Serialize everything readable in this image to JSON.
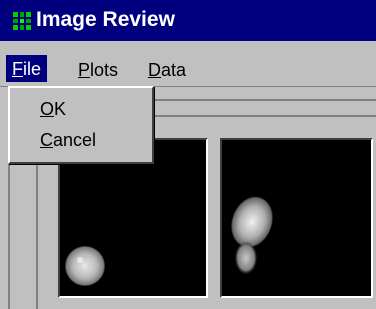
{
  "window": {
    "title": "Image Review",
    "titlebar_color": "#00007e",
    "icon": "app-grid-icon"
  },
  "menubar": {
    "items": [
      {
        "label": "File",
        "mnemonic": "F",
        "rest": "ile",
        "active": true
      },
      {
        "label": "Plots",
        "mnemonic": "P",
        "rest": "lots"
      },
      {
        "label": "Data",
        "mnemonic": "D",
        "rest": "ata"
      }
    ]
  },
  "file_menu": {
    "items": [
      {
        "label": "OK",
        "mnemonic": "O",
        "rest": "K"
      },
      {
        "label": "Cancel",
        "mnemonic": "C",
        "rest": "ancel"
      }
    ]
  },
  "image_panels": [
    {
      "content": "microscopy-cell-image"
    },
    {
      "content": "microscopy-cell-image"
    }
  ]
}
